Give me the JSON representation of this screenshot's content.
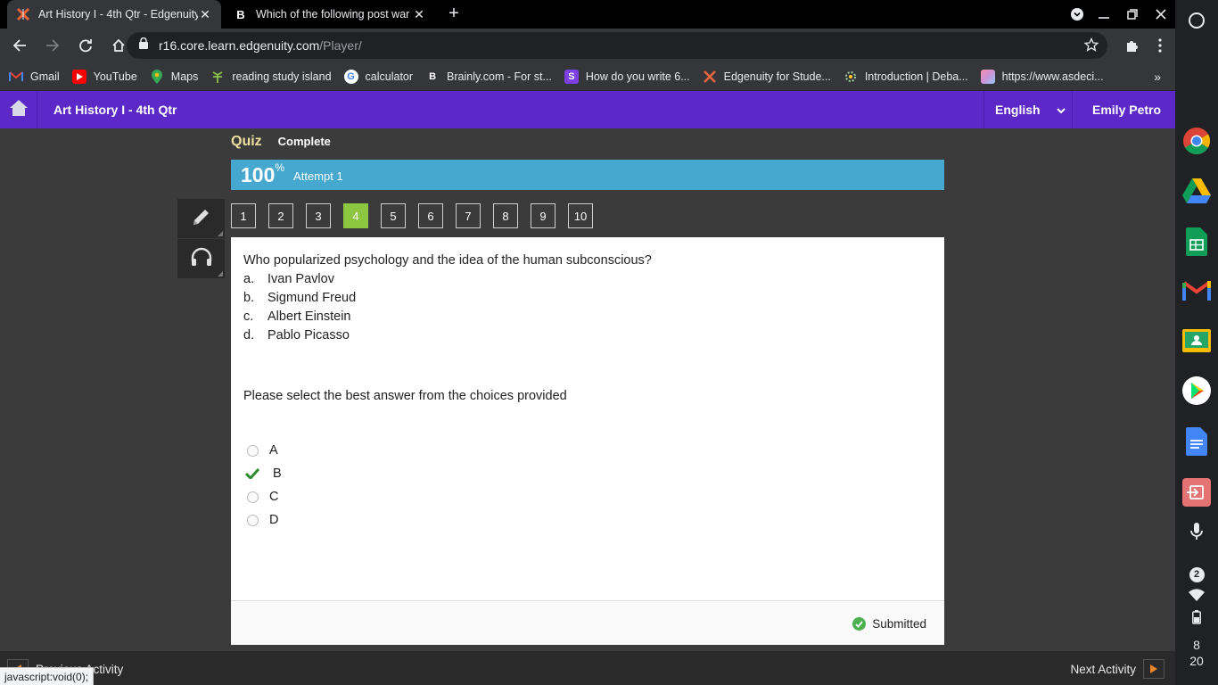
{
  "tabs": [
    {
      "title": "Art History I - 4th Qtr - Edgenuity",
      "favicon": "edgenuity-x-icon",
      "active": true
    },
    {
      "title": "Which of the following post war",
      "favicon": "brainly-b-icon",
      "active": false
    }
  ],
  "omnibox": {
    "host": "r16.core.learn.edgenuity.com",
    "path": "/Player/"
  },
  "bookmarks": [
    {
      "label": "Gmail",
      "icon": "gmail-icon"
    },
    {
      "label": "YouTube",
      "icon": "youtube-icon"
    },
    {
      "label": "Maps",
      "icon": "maps-icon"
    },
    {
      "label": "reading study island",
      "icon": "study-island-icon"
    },
    {
      "label": "calculator",
      "icon": "google-icon"
    },
    {
      "label": "Brainly.com - For st...",
      "icon": "brainly-icon"
    },
    {
      "label": "How do you write 6...",
      "icon": "socratic-icon"
    },
    {
      "label": "Edgenuity for Stude...",
      "icon": "edgenuity-icon"
    },
    {
      "label": "Introduction | Deba...",
      "icon": "debate-icon"
    },
    {
      "label": "https://www.asdeci...",
      "icon": "image-icon"
    }
  ],
  "app": {
    "course_title": "Art History I - 4th Qtr",
    "language": "English",
    "user_name": "Emily Petro"
  },
  "quiz": {
    "label": "Quiz",
    "status": "Complete",
    "score": "100",
    "score_unit": "%",
    "attempt": "Attempt 1",
    "questions": [
      "1",
      "2",
      "3",
      "4",
      "5",
      "6",
      "7",
      "8",
      "9",
      "10"
    ],
    "current_question": "4",
    "question_text": "Who popularized psychology and the idea of the human subconscious?",
    "options": [
      {
        "letter": "a.",
        "text": "Ivan Pavlov"
      },
      {
        "letter": "b.",
        "text": "Sigmund Freud"
      },
      {
        "letter": "c.",
        "text": "Albert Einstein"
      },
      {
        "letter": "d.",
        "text": "Pablo Picasso"
      }
    ],
    "instruction": "Please select the best answer from the choices provided",
    "answers": [
      {
        "label": "A",
        "selected": false
      },
      {
        "label": "B",
        "selected": true
      },
      {
        "label": "C",
        "selected": false
      },
      {
        "label": "D",
        "selected": false
      }
    ],
    "submitted_label": "Submitted"
  },
  "footer": {
    "prev_label": "Previous Activity",
    "next_label": "Next Activity"
  },
  "status_url": "javascript:void(0);",
  "shelf": {
    "clock_hour": "8",
    "clock_minute": "20",
    "notification_count": "2"
  },
  "colors": {
    "appbar": "#5d28c8",
    "scorebar": "#46a7cf",
    "current_question": "#8dc63f",
    "check": "#2e8b2e"
  }
}
